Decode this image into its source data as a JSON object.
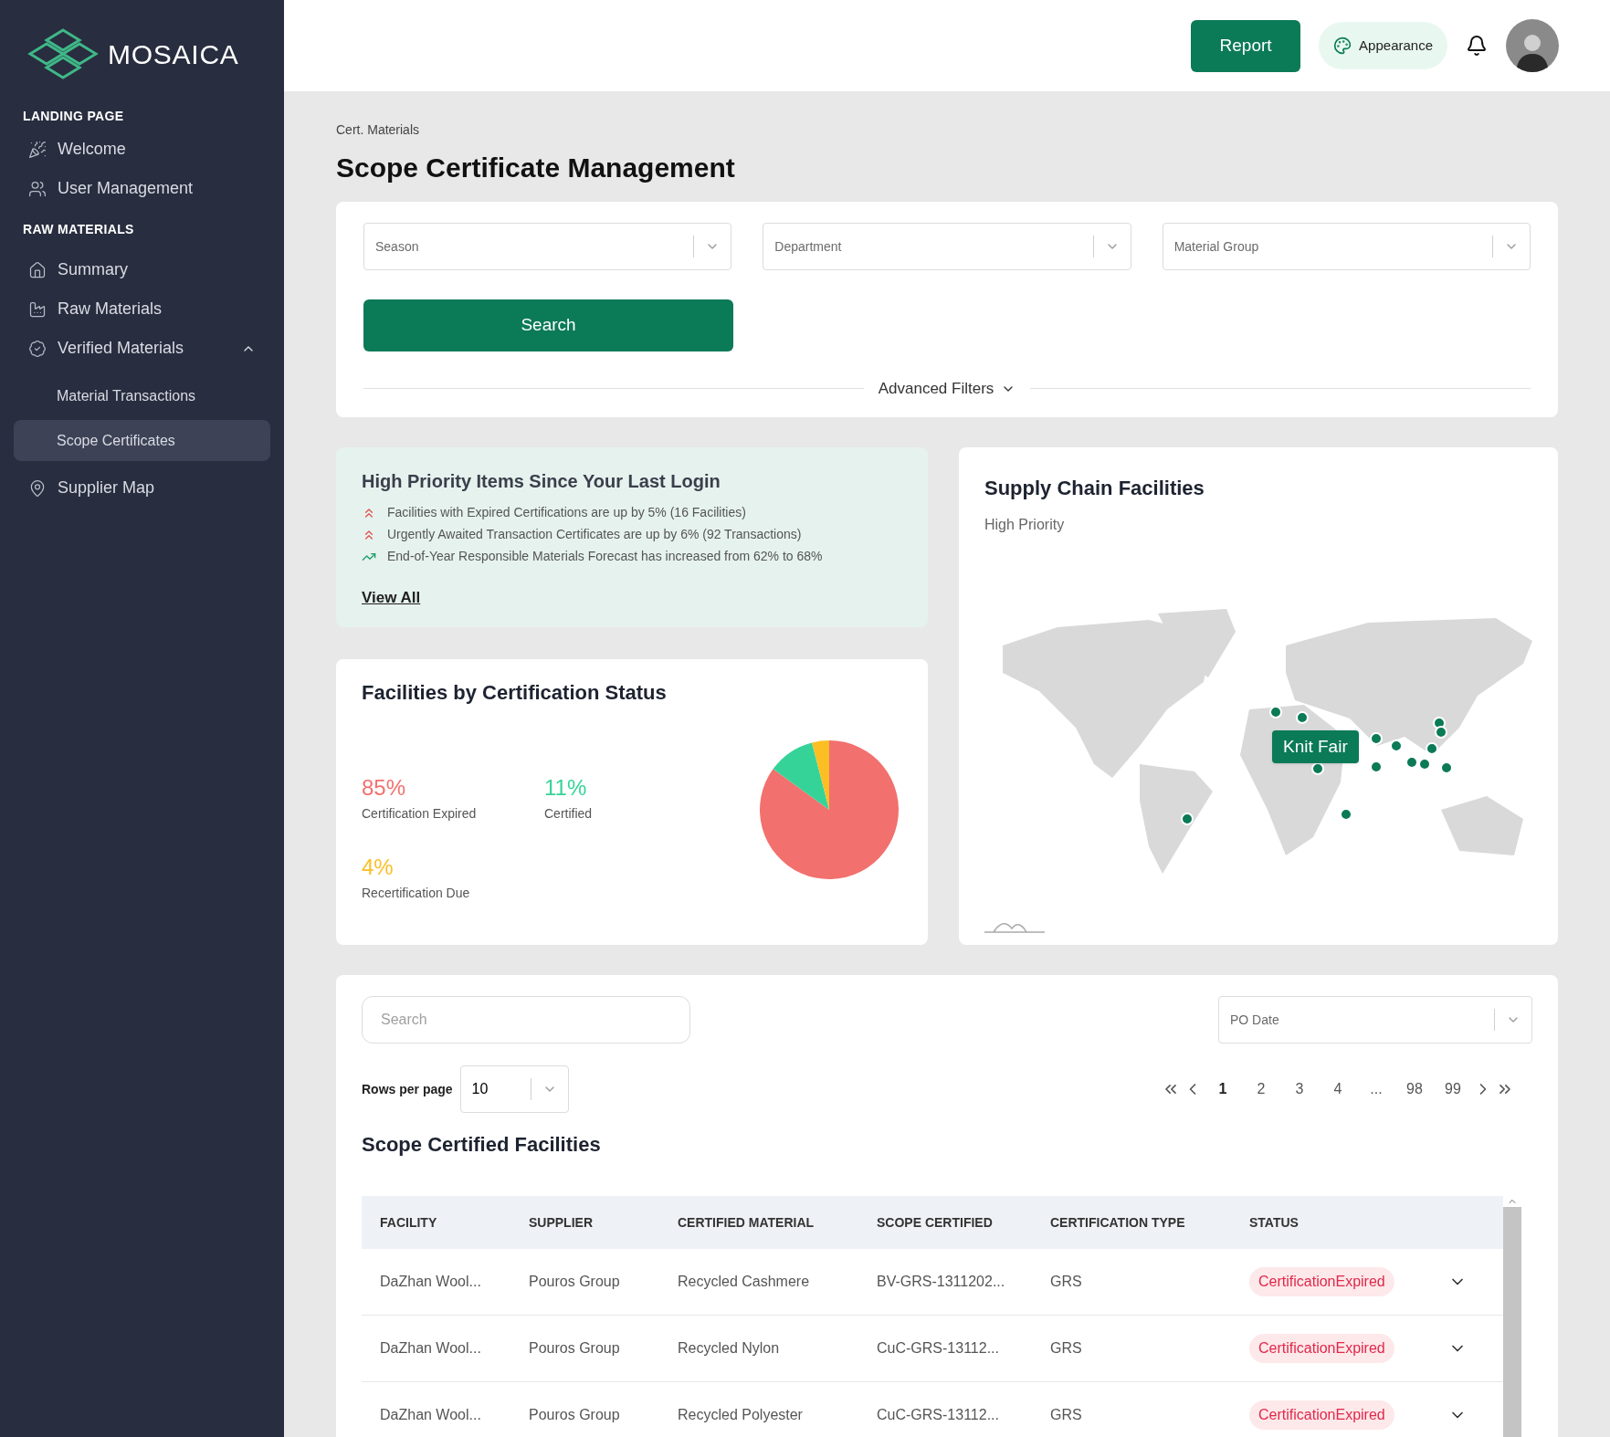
{
  "sidebar": {
    "logo": "MOSAICA",
    "sections": [
      {
        "title": "LANDING PAGE",
        "items": [
          {
            "label": "Welcome",
            "selected": false
          },
          {
            "label": "User Management",
            "selected": false
          }
        ]
      },
      {
        "title": "RAW MATERIALS",
        "items": [
          {
            "label": "Summary",
            "selected": false
          },
          {
            "label": "Raw Materials",
            "selected": false
          },
          {
            "label": "Verified Materials",
            "selected": false,
            "expanded": true,
            "children": [
              {
                "label": "Material Transactions",
                "selected": false
              },
              {
                "label": "Scope Certificates",
                "selected": true
              }
            ]
          },
          {
            "label": "Supplier Map",
            "selected": false
          }
        ]
      }
    ]
  },
  "header": {
    "report_button": "Report",
    "appearance_button": "Appearance"
  },
  "breadcrumb": "Cert. Materials",
  "title": "Scope Certificate Management",
  "filters": {
    "selects": [
      {
        "placeholder": "Season"
      },
      {
        "placeholder": "Department"
      },
      {
        "placeholder": "Material Group"
      }
    ],
    "search_button": "Search",
    "advanced": "Advanced Filters"
  },
  "high_priority": {
    "title": "High Priority Items Since Your Last Login",
    "items": [
      {
        "kind": "up",
        "text": "Facilities with Expired Certifications are up by 5% (16 Facilities)"
      },
      {
        "kind": "up",
        "text": "Urgently Awaited Transaction Certificates are up by 6% (92 Transactions)"
      },
      {
        "kind": "trend",
        "text": "End-of-Year Responsible Materials Forecast has increased from 62% to 68%"
      }
    ],
    "link": "View All"
  },
  "status_card": {
    "title": "Facilities by Certification Status",
    "chart_data": {
      "type": "pie",
      "categories": [
        "Certification Expired",
        "Certified",
        "Recertification Due"
      ],
      "values": [
        85,
        11,
        4
      ],
      "value_labels": [
        "85%",
        "11%",
        "4%"
      ],
      "colors": [
        "#f2706d",
        "#36d399",
        "#fbbf24"
      ]
    }
  },
  "map_card": {
    "title": "Supply Chain Facilities",
    "subtitle": "High Priority",
    "tooltip": "Knit Fair"
  },
  "table_card": {
    "search_placeholder": "Search",
    "date_select": "PO Date",
    "rows_per_page_label": "Rows per page",
    "rows_per_page": "10",
    "pages": [
      {
        "label": "1",
        "selected": true
      },
      {
        "label": "2",
        "selected": false
      },
      {
        "label": "3",
        "selected": false
      },
      {
        "label": "4",
        "selected": false
      },
      {
        "label": "...",
        "selected": false
      },
      {
        "label": "98",
        "selected": false
      },
      {
        "label": "99",
        "selected": false
      }
    ],
    "title": "Scope Certified Facilities",
    "columns": [
      "FACILITY",
      "SUPPLIER",
      "CERTIFIED MATERIAL",
      "SCOPE CERTIFIED",
      "CERTIFICATION TYPE",
      "STATUS"
    ],
    "rows": [
      {
        "facility": "DaZhan Wool...",
        "supplier": "Pouros Group",
        "material": "Recycled Cashmere",
        "scope": "BV-GRS-1311202...",
        "type": "GRS",
        "status": "CertificationExpired"
      },
      {
        "facility": "DaZhan Wool...",
        "supplier": "Pouros Group",
        "material": "Recycled Nylon",
        "scope": "CuC-GRS-13112...",
        "type": "GRS",
        "status": "CertificationExpired"
      },
      {
        "facility": "DaZhan Wool...",
        "supplier": "Pouros Group",
        "material": "Recycled Polyester",
        "scope": "CuC-GRS-13112...",
        "type": "GRS",
        "status": "CertificationExpired"
      }
    ]
  }
}
